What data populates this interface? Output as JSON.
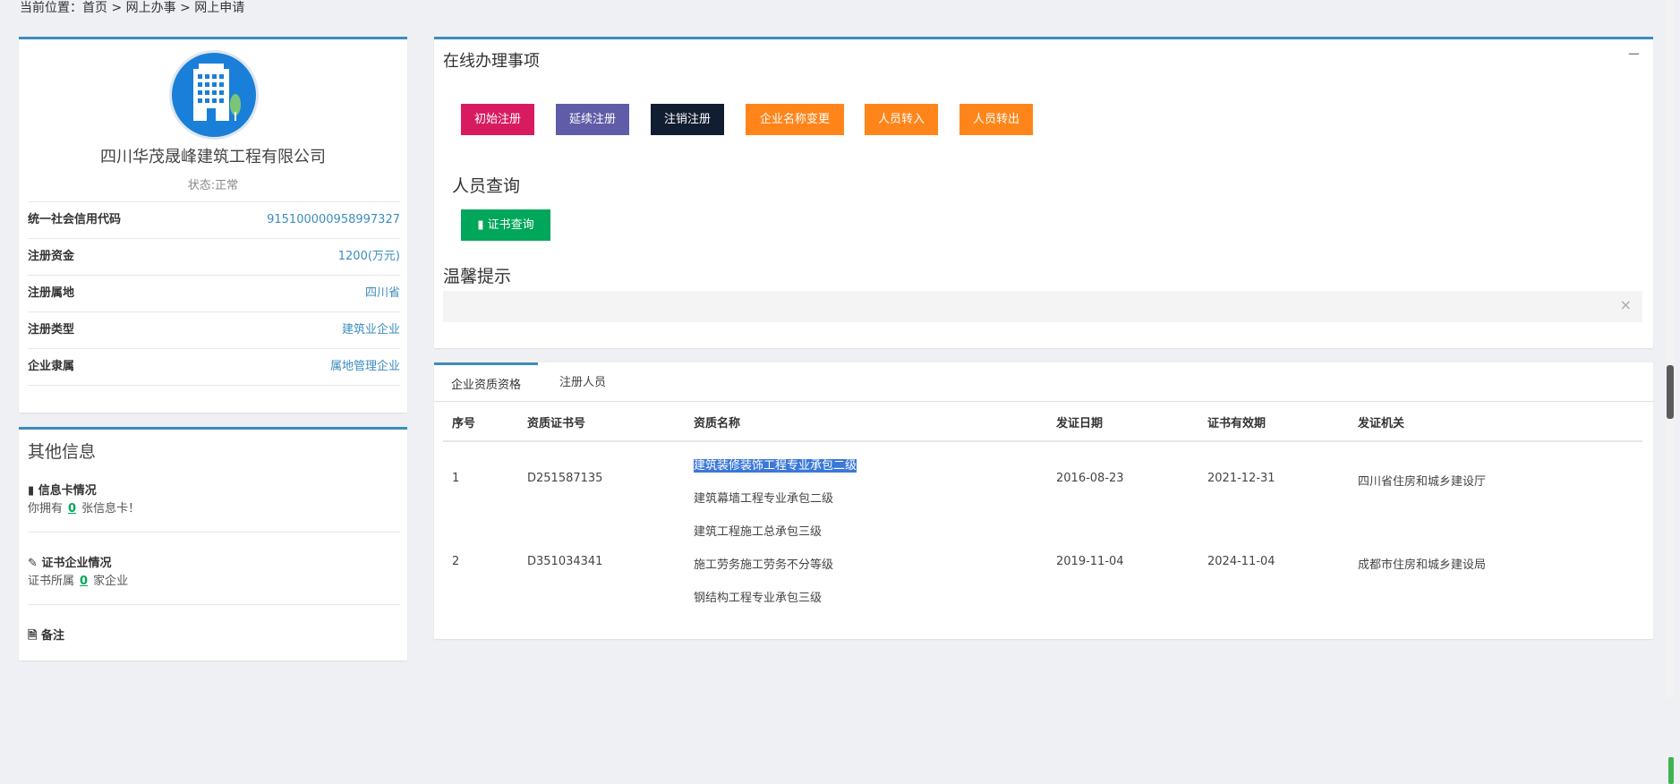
{
  "breadcrumb": "当前位置：首页 > 网上办事 > 网上申请",
  "profile": {
    "company_name": "四川华茂晟峰建筑工程有限公司",
    "status": "状态:正常",
    "rows": [
      {
        "label": "统一社会信用代码",
        "value": "915100000958997327"
      },
      {
        "label": "注册资金",
        "value": "1200(万元)"
      },
      {
        "label": "注册属地",
        "value": "四川省"
      },
      {
        "label": "注册类型",
        "value": "建筑业企业"
      },
      {
        "label": "企业隶属",
        "value": "属地管理企业"
      }
    ]
  },
  "other_info": {
    "title": "其他信息",
    "info_card_title": "信息卡情况",
    "info_card_text_pre": "你拥有",
    "info_card_count": "0",
    "info_card_text_post": "张信息卡！",
    "cert_title": "证书企业情况",
    "cert_text_pre": "证书所属",
    "cert_count": "0",
    "cert_text_post": "家企业",
    "remark_title": "备注"
  },
  "matters": {
    "title": "在线办理事项",
    "collapse": "−",
    "buttons": [
      {
        "label": "初始注册",
        "color": "#d81b60"
      },
      {
        "label": "延续注册",
        "color": "#605ca8"
      },
      {
        "label": "注销注册",
        "color": "#111e31"
      },
      {
        "label": "企业名称变更",
        "color": "#ff851b"
      },
      {
        "label": "人员转入",
        "color": "#ff851b"
      },
      {
        "label": "人员转出",
        "color": "#ff851b"
      }
    ],
    "person_query_title": "人员查询",
    "cert_query_label": "证书查询",
    "cert_query_color": "#00a65a",
    "tip_title": "温馨提示",
    "tip_close": "×"
  },
  "quals": {
    "tabs": [
      "企业资质资格",
      "注册人员"
    ],
    "headers": [
      "序号",
      "资质证书号",
      "资质名称",
      "发证日期",
      "证书有效期",
      "发证机关"
    ],
    "rows": [
      {
        "no": "1",
        "cert_no": "D251587135",
        "names": [
          "建筑装修装饰工程专业承包二级",
          "建筑幕墙工程专业承包二级",
          "建筑工程施工总承包三级"
        ],
        "issue_date": "2016-08-23",
        "valid_until": "2021-12-31",
        "authority": "四川省住房和城乡建设厅"
      },
      {
        "no": "2",
        "cert_no": "D351034341",
        "names": [
          "施工劳务施工劳务不分等级",
          "钢结构工程专业承包三级"
        ],
        "issue_date": "2019-11-04",
        "valid_until": "2024-11-04",
        "authority": "成都市住房和城乡建设局"
      }
    ]
  }
}
